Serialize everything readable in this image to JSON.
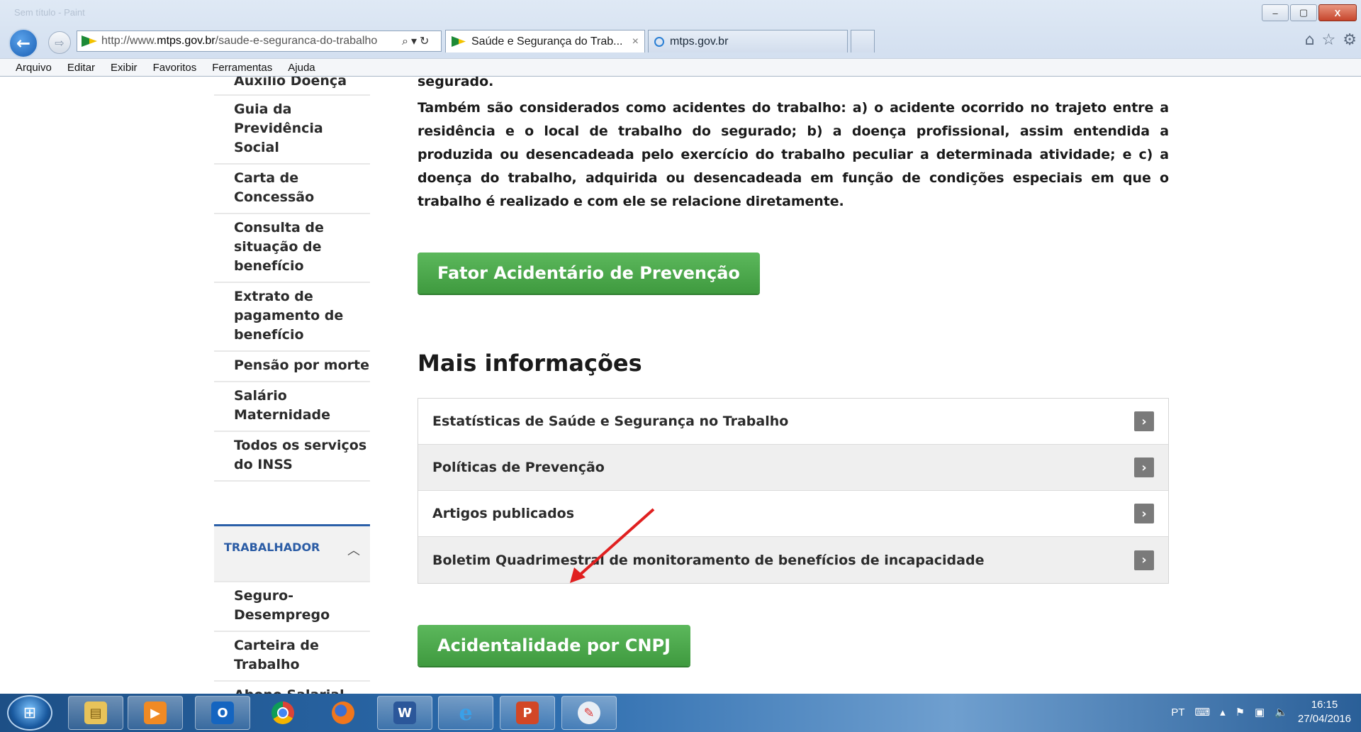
{
  "browser": {
    "window_title_ghost": "Sem título - Paint",
    "url_prefix": "http://www.",
    "url_domain": "mtps.gov.br",
    "url_path": "/saude-e-seguranca-do-trabalho",
    "tabs": [
      {
        "label": "Saúde e Segurança do Trab...",
        "close": "×"
      },
      {
        "label": "mtps.gov.br"
      }
    ],
    "menu": [
      "Arquivo",
      "Editar",
      "Exibir",
      "Favoritos",
      "Ferramentas",
      "Ajuda"
    ],
    "win_controls": {
      "minimize": "–",
      "maximize": "▢",
      "close": "X"
    }
  },
  "sidebar": {
    "cut_item": "Auxílio Doença",
    "items": [
      "Guia da Previdência Social",
      "Carta de Concessão",
      "Consulta de situação de benefício",
      "Extrato de pagamento de benefício",
      "Pensão por morte",
      "Salário Maternidade",
      "Todos os serviços do INSS"
    ],
    "section_title": "TRABALHADOR",
    "section_items": [
      "Seguro-Desemprego",
      "Carteira de Trabalho",
      "Abono Salarial"
    ]
  },
  "main": {
    "lead_cut": "segurado.",
    "paragraph": "Também são considerados como acidentes do trabalho: a) o acidente ocorrido no trajeto entre a residência e o local de trabalho do segurado; b) a doença profissional, assim entendida a produzida ou desencadeada pelo exercício do trabalho peculiar a determinada atividade; e c) a doença do trabalho, adquirida ou desencadeada em função de condições especiais em que o trabalho é realizado e com ele se relacione diretamente.",
    "button1": "Fator Acidentário de Prevenção",
    "more_title": "Mais informações",
    "info_rows": [
      "Estatísticas de Saúde e Segurança no Trabalho",
      "Políticas de Prevenção",
      "Artigos publicados",
      "Boletim Quadrimestral de monitoramento de benefícios de incapacidade"
    ],
    "button2": "Acidentalidade por CNPJ"
  },
  "taskbar": {
    "apps": [
      "file-explorer",
      "media-player",
      "outlook",
      "chrome",
      "firefox",
      "word",
      "internet-explorer",
      "powerpoint",
      "paint"
    ],
    "language": "PT",
    "time": "16:15",
    "date": "27/04/2016"
  },
  "colors": {
    "green": "#4cae4c",
    "section_blue": "#2b5ca5",
    "annotation_red": "#e02020"
  }
}
